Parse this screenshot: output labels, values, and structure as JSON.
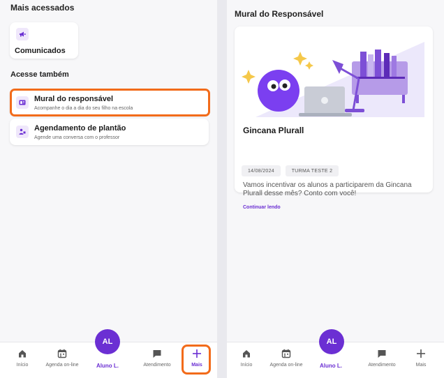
{
  "left": {
    "most_accessed_title": "Mais acessados",
    "comunicados_label": "Comunicados",
    "see_also_title": "Acesse também",
    "items": [
      {
        "title": "Mural do responsável",
        "subtitle": "Acompanhe o dia a dia do seu filho na escola"
      },
      {
        "title": "Agendamento de plantão",
        "subtitle": "Agende uma conversa com o professor"
      }
    ]
  },
  "right": {
    "page_title": "Mural do Responsável",
    "post": {
      "title": "Gincana Plurall",
      "date": "14/08/2024",
      "class_tag": "TURMA TESTE 2",
      "body": "Vamos incentivar os alunos a participarem da Gincana Plurall desse mês? Conto com você!",
      "link": "Continuar lendo"
    }
  },
  "nav": {
    "inicio": "Início",
    "agenda": "Agenda on-line",
    "aluno": "Aluno L.",
    "avatar_initials": "AL",
    "atendimento": "Atendimento",
    "mais": "Mais"
  },
  "colors": {
    "accent": "#6b2fd3",
    "highlight": "#f26b1a"
  },
  "icons": [
    "megaphone-icon",
    "mural-icon",
    "schedule-person-icon",
    "home-icon",
    "calendar-icon",
    "chat-icon",
    "plus-icon"
  ]
}
